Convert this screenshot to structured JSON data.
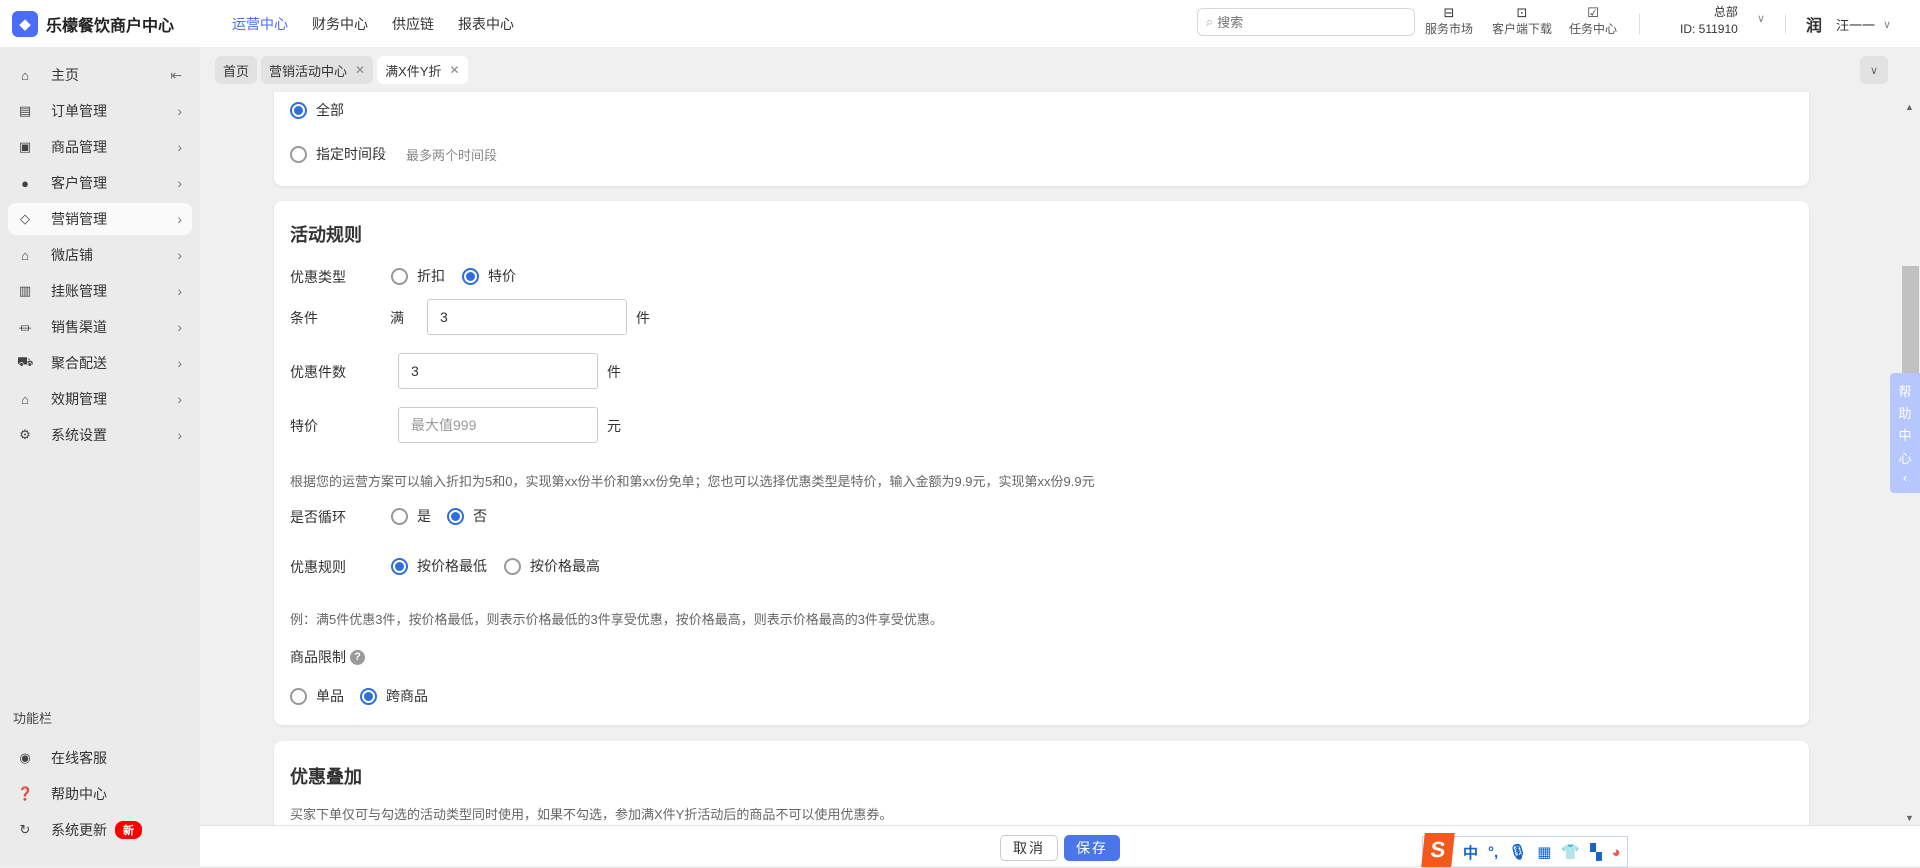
{
  "app": {
    "title": "乐檬餐饮商户中心",
    "logo_icon": "app-logo-icon"
  },
  "topnav": [
    {
      "label": "运营中心",
      "active": true
    },
    {
      "label": "财务中心"
    },
    {
      "label": "供应链"
    },
    {
      "label": "报表中心"
    }
  ],
  "search": {
    "placeholder": "搜索"
  },
  "tools": [
    {
      "label": "服务市场",
      "icon": "briefcase-icon"
    },
    {
      "label": "客户端下载",
      "icon": "folder-download-icon"
    },
    {
      "label": "任务中心",
      "icon": "clipboard-check-icon"
    }
  ],
  "org": {
    "name": "总部",
    "id": "ID: 511910"
  },
  "user": {
    "name": "汪一一",
    "avatar_text": "润"
  },
  "sidebar": {
    "items": [
      {
        "label": "主页",
        "icon": "home-icon"
      },
      {
        "label": "订单管理",
        "icon": "order-icon"
      },
      {
        "label": "商品管理",
        "icon": "box-icon"
      },
      {
        "label": "客户管理",
        "icon": "user-icon"
      },
      {
        "label": "营销管理",
        "icon": "tag-icon",
        "active": true
      },
      {
        "label": "微店铺",
        "icon": "store-icon"
      },
      {
        "label": "挂账管理",
        "icon": "ledger-icon"
      },
      {
        "label": "销售渠道",
        "icon": "bank-icon"
      },
      {
        "label": "聚合配送",
        "icon": "delivery-icon"
      },
      {
        "label": "效期管理",
        "icon": "lock-house-icon"
      },
      {
        "label": "系统设置",
        "icon": "gear-icon"
      }
    ],
    "section_title": "功能栏",
    "footer": [
      {
        "label": "在线客服",
        "icon": "headset-icon"
      },
      {
        "label": "帮助中心",
        "icon": "question-icon"
      },
      {
        "label": "系统更新",
        "icon": "refresh-icon",
        "badge": "新"
      }
    ]
  },
  "tabs": [
    {
      "label": "首页"
    },
    {
      "label": "营销活动中心",
      "closable": true
    },
    {
      "label": "满X件Y折",
      "closable": true,
      "active": true
    }
  ],
  "time_card": {
    "options": [
      {
        "label": "全部",
        "selected": true
      },
      {
        "label": "指定时间段",
        "selected": false
      }
    ],
    "hint": "最多两个时间段"
  },
  "rules": {
    "title": "活动规则",
    "type_label": "优惠类型",
    "type_options": [
      {
        "label": "折扣",
        "selected": false
      },
      {
        "label": "特价",
        "selected": true
      }
    ],
    "cond_label": "条件",
    "cond_prefix": "满",
    "cond_value": "3",
    "cond_unit": "件",
    "count_label": "优惠件数",
    "count_value": "3",
    "count_unit": "件",
    "price_label": "特价",
    "price_placeholder": "最大值999",
    "price_unit": "元",
    "hint": "根据您的运营方案可以输入折扣为5和0，实现第xx份半价和第xx份免单；您也可以选择优惠类型是特价，输入金额为9.9元，实现第xx份9.9元",
    "loop_label": "是否循环",
    "loop_options": [
      {
        "label": "是",
        "selected": false
      },
      {
        "label": "否",
        "selected": true
      }
    ],
    "rule_label": "优惠规则",
    "rule_options": [
      {
        "label": "按价格最低",
        "selected": true
      },
      {
        "label": "按价格最高",
        "selected": false
      }
    ],
    "example": "例：满5件优惠3件，按价格最低，则表示价格最低的3件享受优惠，按价格最高，则表示价格最高的3件享受优惠。",
    "limit_label": "商品限制",
    "limit_options": [
      {
        "label": "单品",
        "selected": false
      },
      {
        "label": "跨商品",
        "selected": true
      }
    ]
  },
  "stack": {
    "title": "优惠叠加",
    "desc": "买家下单仅可与勾选的活动类型同时使用，如果不勾选，参加满X件Y折活动后的商品不可以使用优惠券。"
  },
  "help_widget": {
    "label": [
      "帮",
      "助",
      "中",
      "心"
    ]
  },
  "footer_buttons": {
    "cancel": "取消",
    "save": "保存"
  },
  "ime": {
    "mode": "中",
    "punct": "°,"
  },
  "colors": {
    "accent": "#4a6cf7",
    "radio": "#2d6fdb",
    "badge": "#ff0000",
    "help": "#b5c7fe"
  }
}
